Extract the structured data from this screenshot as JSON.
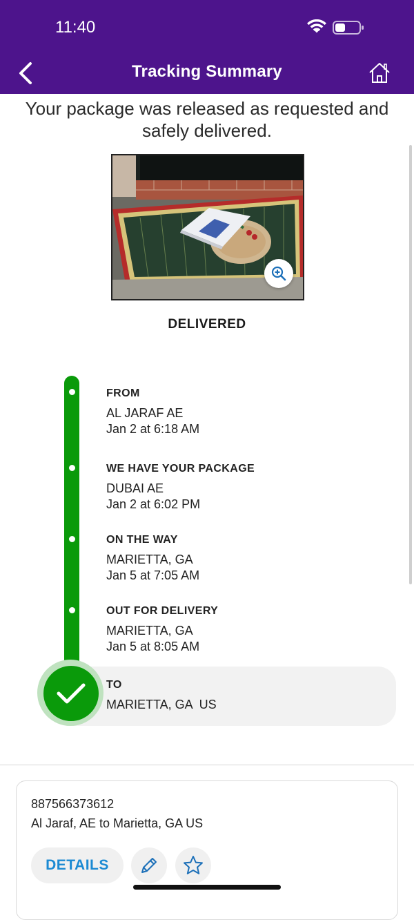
{
  "status_bar": {
    "time": "11:40"
  },
  "nav": {
    "title": "Tracking Summary",
    "back_icon": "chevron-left-icon",
    "home_icon": "home-icon"
  },
  "message": "Your package was released as requested and safely delivered.",
  "photo": {
    "zoom_icon": "zoom-in-icon"
  },
  "delivery_status": "DELIVERED",
  "timeline": [
    {
      "title": "FROM",
      "location": "AL JARAF AE",
      "time": "Jan 2 at 6:18 AM"
    },
    {
      "title": "WE HAVE YOUR PACKAGE",
      "location": "DUBAI AE",
      "time": "Jan 2 at 6:02 PM"
    },
    {
      "title": "ON THE WAY",
      "location": "MARIETTA, GA",
      "time": "Jan 5 at 7:05 AM"
    },
    {
      "title": "OUT FOR DELIVERY",
      "location": "MARIETTA, GA",
      "time": "Jan 5 at 8:05 AM"
    },
    {
      "title": "TO",
      "location": "MARIETTA, GA  US"
    }
  ],
  "card": {
    "tracking_number": "887566373612",
    "route": "Al Jaraf, AE to Marietta, GA US",
    "details_label": "DETAILS",
    "edit_icon": "pencil-icon",
    "favorite_icon": "star-icon"
  },
  "colors": {
    "brand": "#4d148c",
    "progress": "#0a9a0a",
    "link": "#1b8ad3"
  }
}
